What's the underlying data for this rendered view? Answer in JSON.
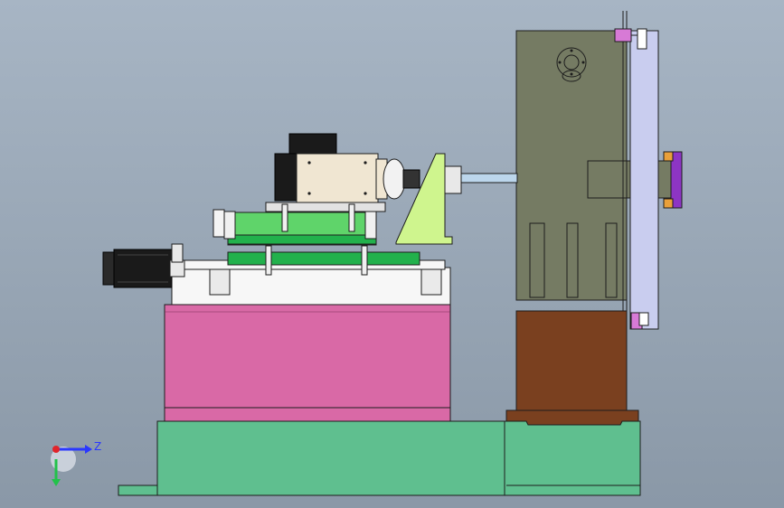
{
  "window": {
    "title": ""
  },
  "viewport": {
    "background_top": "#a7b5c4",
    "background_bottom": "#8a98a7"
  },
  "colors": {
    "base_green": "#5fbf8f",
    "pink_block": "#d969a6",
    "column_gray": "#757b63",
    "brown_block": "#7a401f",
    "lavender_plate": "#c9cdef",
    "spindle_cream": "#f0e6d2",
    "slide_green": "#22b14c",
    "bracket_yellowgreen": "#cff58e",
    "motor_black": "#1a1a1a",
    "magenta_clamp": "#d77ad6"
  },
  "triad": {
    "icons": [
      "y-axis-icon",
      "z-axis-icon"
    ],
    "z_label": "Z"
  }
}
